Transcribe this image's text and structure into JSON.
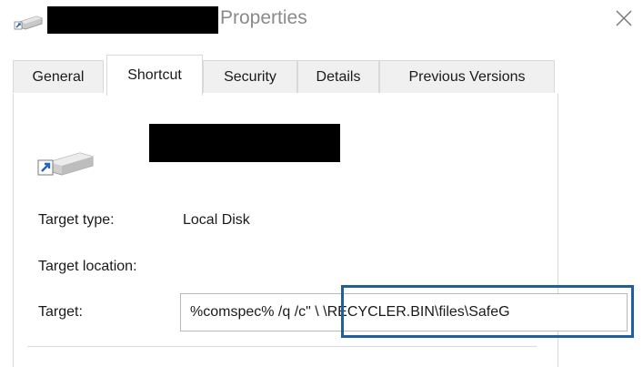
{
  "window": {
    "title": "Properties",
    "title_icon": "drive-shortcut-icon",
    "close_icon": "close-icon"
  },
  "tabs": [
    {
      "label": "General",
      "active": false
    },
    {
      "label": "Shortcut",
      "active": true
    },
    {
      "label": "Security",
      "active": false
    },
    {
      "label": "Details",
      "active": false
    },
    {
      "label": "Previous Versions",
      "active": false
    }
  ],
  "shortcut": {
    "icon": "drive-shortcut-icon",
    "target_type_label": "Target type:",
    "target_type_value": "Local Disk",
    "target_location_label": "Target location:",
    "target_label": "Target:",
    "target_value": "%comspec% /q /c\" \\ \\RECYCLER.BIN\\files\\SafeG"
  },
  "colors": {
    "highlight_border": "#1f5f9b",
    "tab_inactive_bg": "#f0f0f0",
    "title_text": "#8a8a8a"
  }
}
